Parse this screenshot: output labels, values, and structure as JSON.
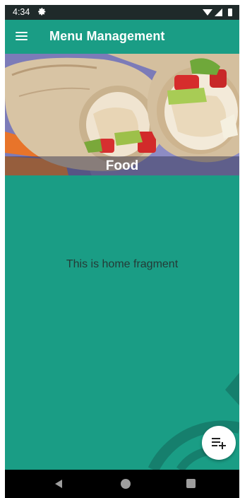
{
  "status_bar": {
    "time": "4:34",
    "left_icons": [
      "settings-icon"
    ],
    "right_icons": [
      "wifi-icon",
      "signal-icon",
      "battery-icon"
    ]
  },
  "app_bar": {
    "menu_icon": "hamburger-menu-icon",
    "title": "Menu Management"
  },
  "banner": {
    "label": "Food",
    "image": "chicken-wrap-photo"
  },
  "home": {
    "message": "This is home fragment"
  },
  "fab": {
    "icon": "playlist-add-icon"
  },
  "nav_bar": {
    "icons": [
      "back-icon",
      "home-icon",
      "recents-icon"
    ]
  },
  "colors": {
    "primary": "#1a9d85",
    "status_bar": "#1f2a2a",
    "nav_bar": "#000000",
    "text_dark": "#243a36"
  }
}
